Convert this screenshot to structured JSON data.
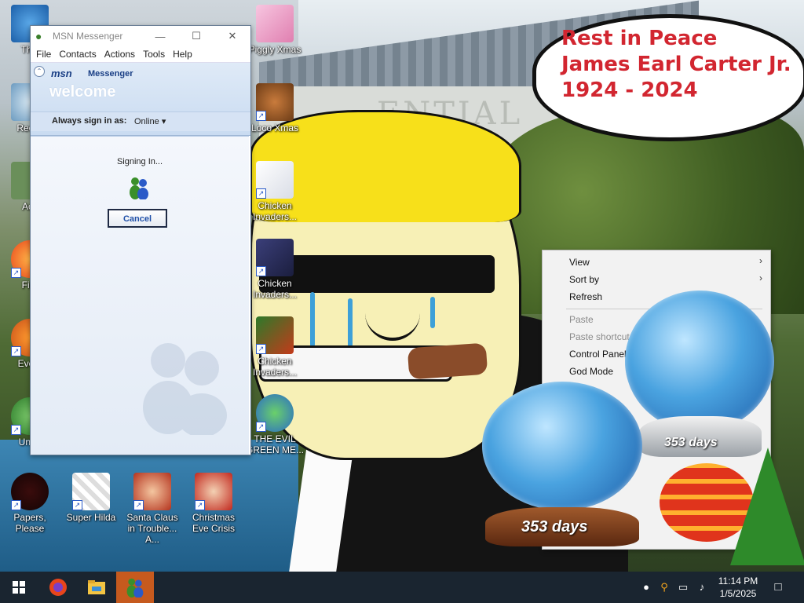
{
  "wallpaper": {
    "bubble_lines": [
      "Rest in Peace",
      "James Earl Carter Jr.",
      "1924 - 2024"
    ]
  },
  "desktop_icons": [
    {
      "label": "This",
      "icon": "this-pc-icon"
    },
    {
      "label": "Recyc",
      "icon": "recycle-bin-icon"
    },
    {
      "label": "Acti",
      "icon": "activate-icon"
    },
    {
      "label": "Fire",
      "icon": "firefox-icon"
    },
    {
      "label": "Every",
      "icon": "everything-icon"
    },
    {
      "label": "Undo",
      "icon": "undo-icon"
    },
    {
      "label": "Piggly Xmas",
      "icon": "piggly-xmas-icon"
    },
    {
      "label": "Loco Xmas",
      "icon": "loco-xmas-icon"
    },
    {
      "label": "Chicken Invaders...",
      "icon": "chicken-invaders-icon"
    },
    {
      "label": "Chicken Invaders...",
      "icon": "chicken-invaders-icon"
    },
    {
      "label": "Chicken Invaders...",
      "icon": "chicken-invaders-icon"
    },
    {
      "label": "THE EVIL GREEN ME...",
      "icon": "evil-green-icon"
    },
    {
      "label": "Papers, Please",
      "icon": "papers-please-icon"
    },
    {
      "label": "Super Hilda",
      "icon": "super-hilda-icon"
    },
    {
      "label": "Santa Claus in Trouble... A...",
      "icon": "santa-claus-icon"
    },
    {
      "label": "Christmas Eve Crisis",
      "icon": "christmas-eve-icon"
    }
  ],
  "msn": {
    "window_title": "MSN Messenger",
    "menu": [
      "File",
      "Contacts",
      "Actions",
      "Tools",
      "Help"
    ],
    "logo": "msn",
    "logo_suffix": "Messenger",
    "welcome": "welcome",
    "signin_label": "Always sign in as:",
    "signin_status": "Online",
    "signing_text": "Signing In...",
    "cancel_label": "Cancel"
  },
  "context_menu": {
    "items": [
      {
        "label": "View",
        "enabled": true,
        "submenu": true
      },
      {
        "label": "Sort by",
        "enabled": true,
        "submenu": true
      },
      {
        "label": "Refresh",
        "enabled": true,
        "submenu": false
      },
      {
        "label": "Paste",
        "enabled": false,
        "submenu": false
      },
      {
        "label": "Paste shortcut",
        "enabled": false,
        "submenu": false
      },
      {
        "label": "Control Panel",
        "enabled": true,
        "submenu": false
      },
      {
        "label": "God Mode",
        "enabled": true,
        "submenu": false
      }
    ]
  },
  "gadgets": {
    "globe_large_days": "353 days",
    "globe_small_days": "353 days"
  },
  "taskbar": {
    "time": "11:14 PM",
    "date": "1/5/2025",
    "apps": [
      "start",
      "firefox",
      "file-explorer",
      "msn-messenger"
    ]
  },
  "colors": {
    "bubble_text": "#d22630",
    "taskbar": "#1a2530",
    "active_app": "#c65a1e",
    "msn_header": "#c9dbf1"
  }
}
